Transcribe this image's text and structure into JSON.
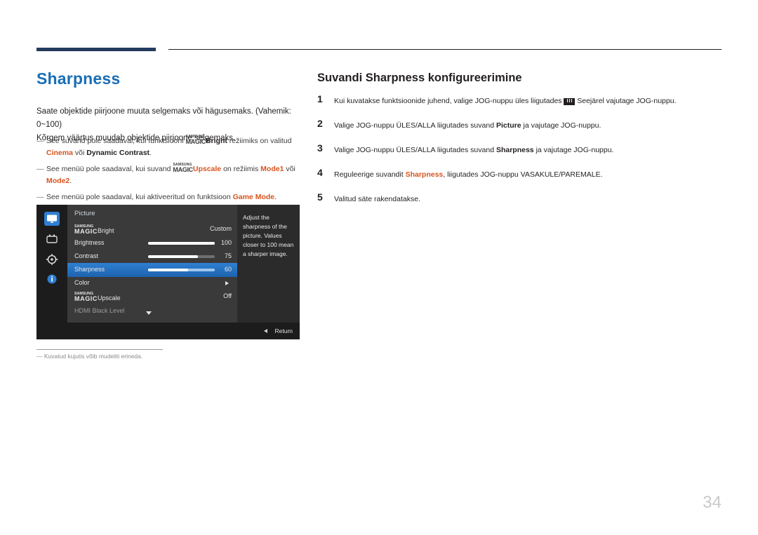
{
  "chapter": {
    "title": "Sharpness",
    "lead_line1": "Saate objektide piirjoone muuta selgemaks või hägusemaks. (Vahemik: 0~100)",
    "lead_line2": "Kõrgem väärtus muudab objektide piirjoone selgemaks."
  },
  "notes": [
    {
      "pre": "See suvand pole saadaval, kui funktsiooni ",
      "logo_top": "SAMSUNG",
      "logo_bot": "MAGIC",
      "bold1": "Bright",
      "mid": " režiimiks on valitud ",
      "hl1": "Cinema",
      "mid2": " või ",
      "hl2": "Dynamic Contrast",
      "post": "."
    },
    {
      "pre": "See menüü pole saadaval, kui suvand ",
      "logo_top": "SAMSUNG",
      "logo_bot": "MAGIC",
      "bold1": "Upscale",
      "mid": " on režiimis ",
      "hl1": "Mode1",
      "mid2": " või ",
      "hl2": "Mode2",
      "post": "."
    },
    {
      "pre": "See menüü pole saadaval, kui aktiveeritud on funktsioon ",
      "hl1": "Game Mode",
      "post": "."
    }
  ],
  "osd": {
    "title": "Picture",
    "icons": [
      "monitor-icon",
      "pc-input-icon",
      "gear-icon",
      "info-icon"
    ],
    "rows": [
      {
        "label_top": "SAMSUNG",
        "label_bot": "MAGIC",
        "label": "Bright",
        "value": "Custom",
        "type": "text"
      },
      {
        "label": "Brightness",
        "value": "100",
        "type": "slider",
        "fill": 100
      },
      {
        "label": "Contrast",
        "value": "75",
        "type": "slider",
        "fill": 75
      },
      {
        "label": "Sharpness",
        "value": "60",
        "type": "slider",
        "fill": 60,
        "selected": true
      },
      {
        "label": "Color",
        "value": "",
        "type": "submenu"
      },
      {
        "label_top": "SAMSUNG",
        "label_bot": "MAGIC",
        "label": "Upscale",
        "value": "Off",
        "type": "text"
      },
      {
        "label": "HDMI Black Level",
        "value": "",
        "type": "more"
      }
    ],
    "help_text": "Adjust the sharpness of the picture. Values closer to 100 mean a sharper image.",
    "return_label": "Return"
  },
  "footnote": "Kuvatud kujutis võib mudeliti erineda.",
  "right": {
    "title": "Suvandi Sharpness konfigureerimine",
    "steps": [
      {
        "num": "1",
        "parts": [
          {
            "t": "text",
            "v": "Kui kuvatakse funktsioonide juhend, valige JOG-nuppu üles liigutades "
          },
          {
            "t": "jog",
            "v": "≡"
          },
          {
            "t": "text",
            "v": " Seejärel vajutage JOG-nuppu."
          }
        ]
      },
      {
        "num": "2",
        "parts": [
          {
            "t": "text",
            "v": "Valige JOG-nuppu ÜLES/ALLA liigutades suvand "
          },
          {
            "t": "bold",
            "v": "Picture"
          },
          {
            "t": "text",
            "v": " ja vajutage JOG-nuppu."
          }
        ]
      },
      {
        "num": "3",
        "parts": [
          {
            "t": "text",
            "v": "Valige JOG-nuppu ÜLES/ALLA liigutades suvand "
          },
          {
            "t": "bold",
            "v": "Sharpness"
          },
          {
            "t": "text",
            "v": " ja vajutage JOG-nuppu."
          }
        ]
      },
      {
        "num": "4",
        "parts": [
          {
            "t": "text",
            "v": "Reguleerige suvandit "
          },
          {
            "t": "bold",
            "v": "Sharpness"
          },
          {
            "t": "text",
            "v": ", liigutades JOG-nuppu VASAKULE/PAREMALE."
          }
        ]
      },
      {
        "num": "5",
        "parts": [
          {
            "t": "text",
            "v": "Valitud säte rakendatakse."
          }
        ]
      }
    ]
  },
  "page_number": "34",
  "colors": {
    "accent_blue": "#1a6eb5",
    "rule_navy": "#243b5e",
    "highlight_orange": "#d9531e",
    "osd_selected": "#2f7fd1"
  }
}
